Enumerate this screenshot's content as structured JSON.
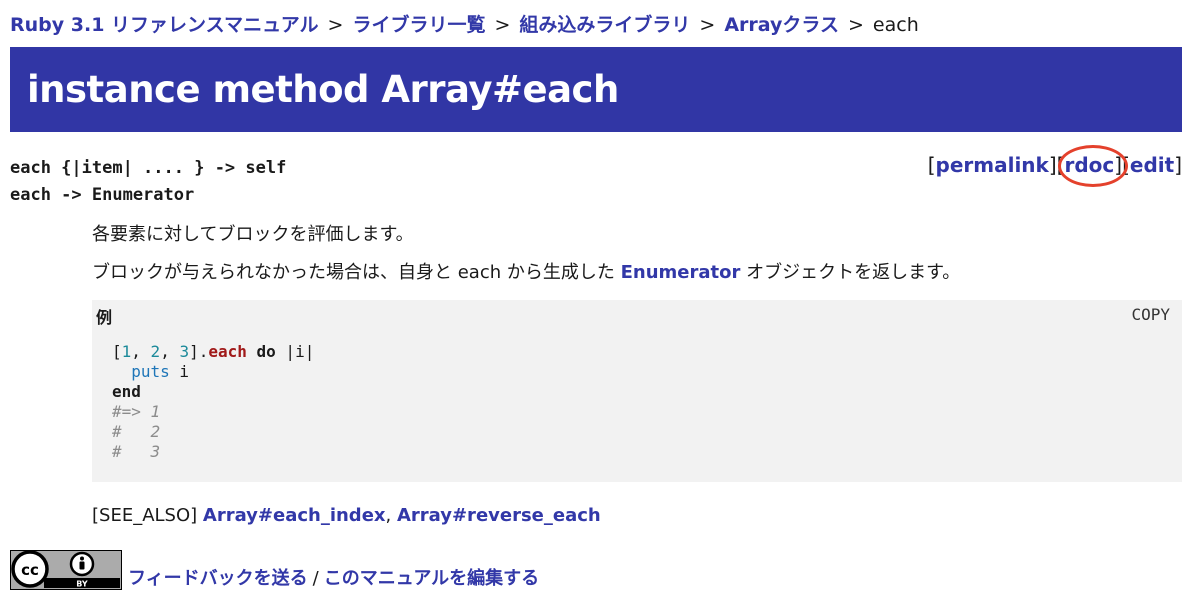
{
  "breadcrumb": {
    "root": "Ruby 3.1 リファレンスマニュアル",
    "library_list": "ライブラリ一覧",
    "builtin": "組み込みライブラリ",
    "class": "Arrayクラス",
    "current": "each",
    "separator": ">"
  },
  "title": "instance method Array#each",
  "signatures": [
    "each {|item| .... } -> self",
    "each -> Enumerator"
  ],
  "links": {
    "permalink": "permalink",
    "rdoc": "rdoc",
    "edit": "edit"
  },
  "description": {
    "line1": "各要素に対してブロックを評価します。",
    "line2_before": "ブロックが与えられなかった場合は、自身と each から生成した ",
    "line2_link": "Enumerator",
    "line2_after": " オブジェクトを返します。"
  },
  "example": {
    "caption": "例",
    "copy_label": "COPY",
    "code": {
      "open_bracket": "[",
      "n1": "1",
      "comma1": ", ",
      "n2": "2",
      "comma2": ", ",
      "n3": "3",
      "close": "].",
      "method": "each",
      "do_kw": " do",
      "block_param": " |i|",
      "puts_call": "puts",
      "puts_arg": " i",
      "end_kw": "end",
      "out1": "#=> 1",
      "out2": "#   2",
      "out3": "#   3"
    }
  },
  "see_also": {
    "label": "[SEE_ALSO]",
    "link1": "Array#each_index",
    "link2": "Array#reverse_each"
  },
  "footer": {
    "feedback": "フィードバックを送る",
    "edit_manual": "このマニュアルを編集する",
    "badge_text": "BY"
  },
  "colors": {
    "accent": "#3136a5",
    "link": "#3238a8",
    "highlight_circle": "#e4412c"
  }
}
